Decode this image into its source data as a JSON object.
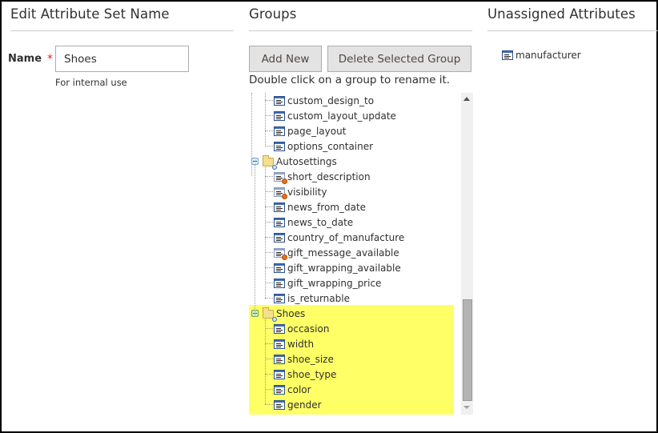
{
  "edit_panel": {
    "title": "Edit Attribute Set Name",
    "name_label": "Name",
    "required_mark": "*",
    "name_value": "Shoes",
    "name_note": "For internal use"
  },
  "groups_panel": {
    "title": "Groups",
    "add_new_label": "Add New",
    "delete_label": "Delete Selected Group",
    "hint": "Double click on a group to rename it.",
    "tree": {
      "partial_group_items": [
        {
          "label": "custom_design_to",
          "system": false
        },
        {
          "label": "custom_layout_update",
          "system": false
        },
        {
          "label": "page_layout",
          "system": false
        },
        {
          "label": "options_container",
          "system": false
        }
      ],
      "groups": [
        {
          "label": "Autosettings",
          "selected": false,
          "items": [
            {
              "label": "short_description",
              "system": true
            },
            {
              "label": "visibility",
              "system": true
            },
            {
              "label": "news_from_date",
              "system": false
            },
            {
              "label": "news_to_date",
              "system": false
            },
            {
              "label": "country_of_manufacture",
              "system": false
            },
            {
              "label": "gift_message_available",
              "system": true
            },
            {
              "label": "gift_wrapping_available",
              "system": false
            },
            {
              "label": "gift_wrapping_price",
              "system": false
            },
            {
              "label": "is_returnable",
              "system": false
            }
          ]
        },
        {
          "label": "Shoes",
          "selected": true,
          "items": [
            {
              "label": "occasion",
              "system": false
            },
            {
              "label": "width",
              "system": false
            },
            {
              "label": "shoe_size",
              "system": false
            },
            {
              "label": "shoe_type",
              "system": false
            },
            {
              "label": "color",
              "system": false
            },
            {
              "label": "gender",
              "system": false
            }
          ]
        }
      ]
    },
    "highlight_color": "#ffff66"
  },
  "unassigned_panel": {
    "title": "Unassigned Attributes",
    "items": [
      {
        "label": "manufacturer"
      }
    ]
  }
}
